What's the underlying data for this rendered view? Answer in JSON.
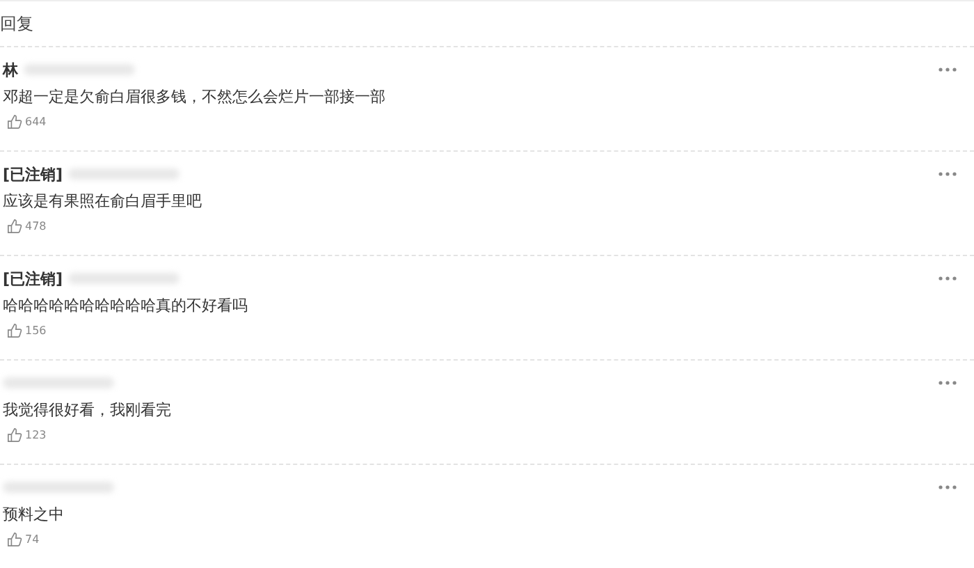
{
  "header": {
    "title": "回复"
  },
  "comments": [
    {
      "user": "林",
      "text": "邓超一定是欠俞白眉很多钱，不然怎么会烂片一部接一部",
      "likes": "644"
    },
    {
      "user": "[已注销]",
      "text": "应该是有果照在俞白眉手里吧",
      "likes": "478"
    },
    {
      "user": "[已注销]",
      "text": "哈哈哈哈哈哈哈哈哈哈真的不好看吗",
      "likes": "156"
    },
    {
      "text": "我觉得很好看，我刚看完",
      "likes": "123"
    },
    {
      "text": "预料之中",
      "likes": "74"
    }
  ]
}
